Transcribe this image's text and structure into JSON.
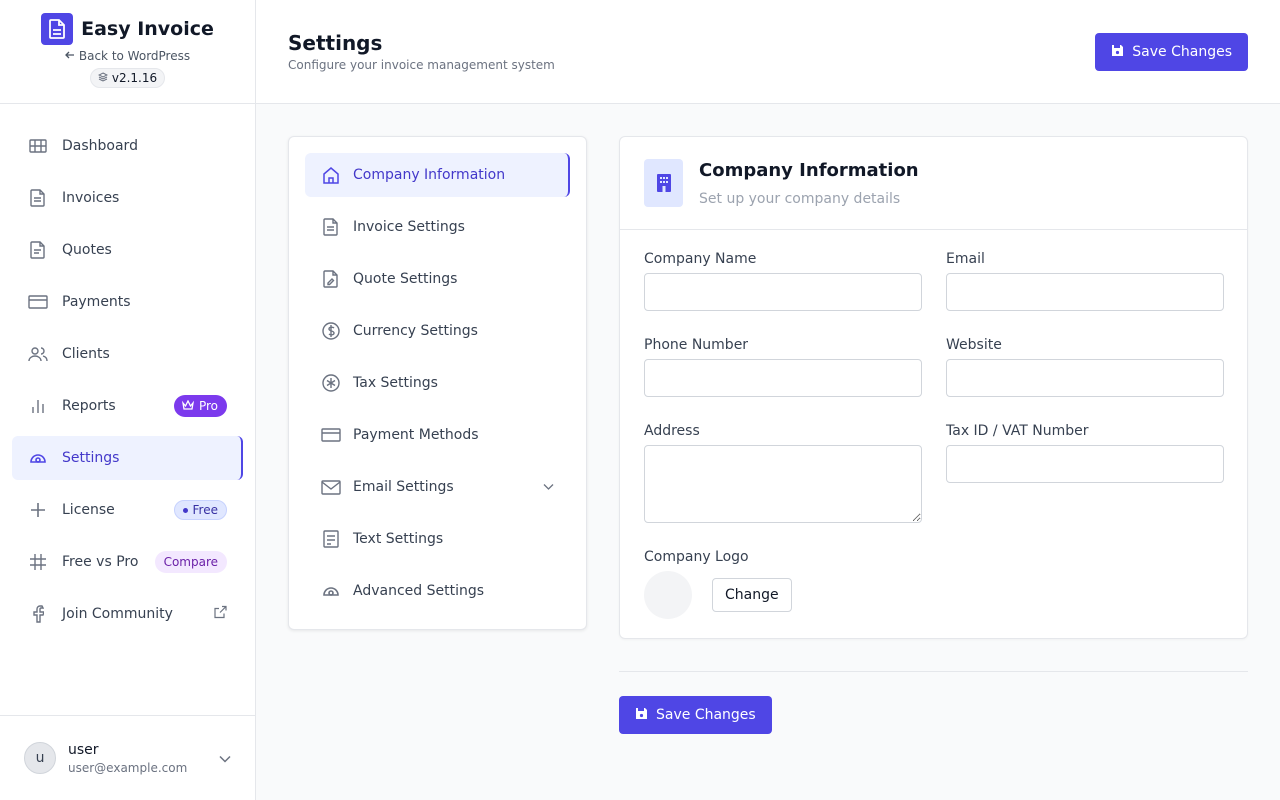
{
  "brand": {
    "title": "Easy Invoice",
    "back_link": "Back to WordPress",
    "version": "v2.1.16",
    "accent_color": "#4f46e5"
  },
  "sidebar": {
    "items": [
      {
        "label": "Dashboard",
        "icon": "grid-icon"
      },
      {
        "label": "Invoices",
        "icon": "document-icon"
      },
      {
        "label": "Quotes",
        "icon": "document-icon"
      },
      {
        "label": "Payments",
        "icon": "credit-card-icon"
      },
      {
        "label": "Clients",
        "icon": "users-icon"
      },
      {
        "label": "Reports",
        "icon": "bar-chart-icon",
        "badge": "Pro"
      },
      {
        "label": "Settings",
        "icon": "settings-icon",
        "active": true
      },
      {
        "label": "License",
        "icon": "sparkle-icon",
        "badge": "Free"
      },
      {
        "label": "Free vs Pro",
        "icon": "grid-lines-icon",
        "badge": "Compare"
      },
      {
        "label": "Join Community",
        "icon": "facebook-icon",
        "external": true
      }
    ]
  },
  "user": {
    "initial": "u",
    "name": "user",
    "email": "user@example.com"
  },
  "header": {
    "title": "Settings",
    "subtitle": "Configure your invoice management system",
    "save_label": "Save Changes"
  },
  "settings_menu": {
    "items": [
      {
        "label": "Company Information",
        "icon": "home-icon",
        "active": true
      },
      {
        "label": "Invoice Settings",
        "icon": "document-icon"
      },
      {
        "label": "Quote Settings",
        "icon": "document-edit-icon"
      },
      {
        "label": "Currency Settings",
        "icon": "dollar-icon"
      },
      {
        "label": "Tax Settings",
        "icon": "asterisk-icon"
      },
      {
        "label": "Payment Methods",
        "icon": "credit-card-icon"
      },
      {
        "label": "Email Settings",
        "icon": "mail-icon",
        "expandable": true
      },
      {
        "label": "Text Settings",
        "icon": "text-file-icon"
      },
      {
        "label": "Advanced Settings",
        "icon": "settings-icon"
      }
    ]
  },
  "company_info": {
    "title": "Company Information",
    "subtitle": "Set up your company details",
    "fields": {
      "company_name": {
        "label": "Company Name",
        "value": ""
      },
      "email": {
        "label": "Email",
        "value": ""
      },
      "phone": {
        "label": "Phone Number",
        "value": ""
      },
      "website": {
        "label": "Website",
        "value": ""
      },
      "address": {
        "label": "Address",
        "value": ""
      },
      "tax_id": {
        "label": "Tax ID / VAT Number",
        "value": ""
      }
    },
    "logo": {
      "label": "Company Logo",
      "button": "Change"
    }
  },
  "footer": {
    "save_label": "Save Changes"
  }
}
